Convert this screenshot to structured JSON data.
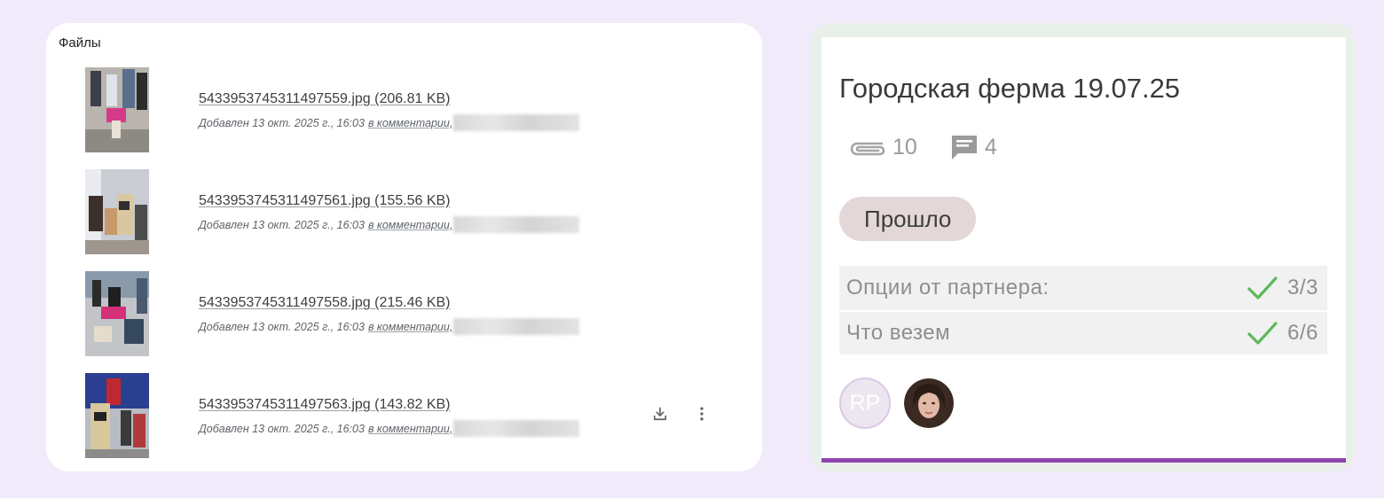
{
  "files": {
    "title": "Файлы",
    "items": [
      {
        "name": "5433953745311497559.jpg (206.81 KB)",
        "added": "Добавлен 13 окт. 2025 г., 16:03",
        "link": "в комментарии,"
      },
      {
        "name": "5433953745311497561.jpg (155.56 KB)",
        "added": "Добавлен 13 окт. 2025 г., 16:03",
        "link": "в комментарии,"
      },
      {
        "name": "5433953745311497558.jpg (215.46 KB)",
        "added": "Добавлен 13 окт. 2025 г., 16:03",
        "link": "в комментарии,"
      },
      {
        "name": "5433953745311497563.jpg (143.82 KB)",
        "added": "Добавлен 13 окт. 2025 г., 16:03",
        "link": "в комментарии,"
      }
    ],
    "row_actions": {
      "download_icon": "download-icon",
      "more_icon": "more-vertical-icon"
    }
  },
  "card": {
    "title": "Городская ферма 19.07.25",
    "attachments_count": "10",
    "comments_count": "4",
    "status": "Прошло",
    "checklists": [
      {
        "label": "Опции от партнера:",
        "progress": "3/3"
      },
      {
        "label": "Что везем",
        "progress": "6/6"
      }
    ],
    "members": [
      {
        "initials": "RP"
      },
      {
        "initials": ""
      }
    ],
    "colors": {
      "accent": "#8e44ad",
      "check": "#5cb85c",
      "status_bg": "#e4d7d7"
    }
  }
}
